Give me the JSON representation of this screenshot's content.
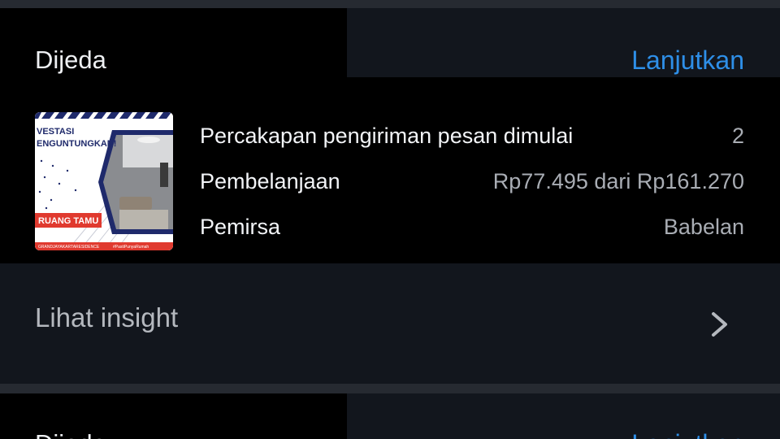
{
  "cards": [
    {
      "status": "Dijeda",
      "resume_label": "Lanjutkan",
      "thumbnail": {
        "headline_line1": "VESTASI",
        "headline_line2": "ENGUNTUNGKAN!",
        "room_label": "RUANG TAMU",
        "footer_left": "GRANDJAYAKARTARESIDENCE",
        "footer_right": "#PastiPunyaRumah"
      },
      "metrics": [
        {
          "label": "Percakapan pengiriman pesan dimulai",
          "value": "2"
        },
        {
          "label": "Pembelanjaan",
          "value": "Rp77.495 dari Rp161.270"
        },
        {
          "label": "Pemirsa",
          "value": "Babelan"
        }
      ],
      "insight_label": "Lihat insight"
    },
    {
      "status": "Dijeda",
      "resume_label": "Lanjutkan"
    }
  ],
  "colors": {
    "background": "#000000",
    "panel": "#12161d",
    "divider": "#262a31",
    "accent": "#2e8fe8",
    "text_primary": "#f2f4f7",
    "text_secondary": "#a9adb4"
  }
}
